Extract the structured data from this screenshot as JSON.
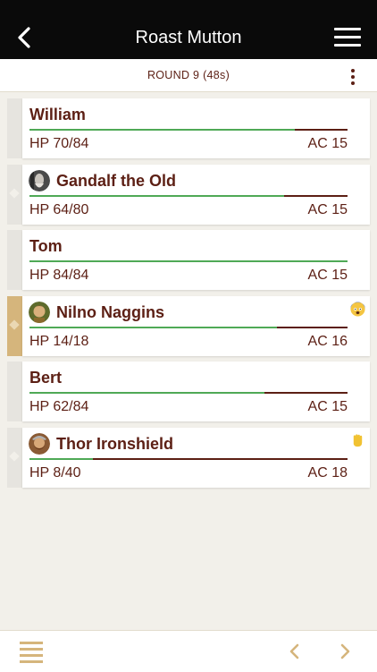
{
  "header": {
    "title": "Roast Mutton",
    "back_icon": "chevron-left-icon",
    "menu_icon": "hamburger-menu-icon"
  },
  "round": {
    "label": "ROUND 9 (48s)",
    "more_icon": "kebab-menu-icon"
  },
  "combatants": [
    {
      "name": "William",
      "hp": "HP 70/84",
      "ac": "AC 15",
      "hp_fraction": 0.833,
      "avatar": null,
      "condition_icon": null,
      "active": false
    },
    {
      "name": "Gandalf the Old",
      "hp": "HP 64/80",
      "ac": "AC 15",
      "hp_fraction": 0.8,
      "avatar": "avatar-gandalf",
      "condition_icon": null,
      "active": false
    },
    {
      "name": "Tom",
      "hp": "HP 84/84",
      "ac": "AC 15",
      "hp_fraction": 1.0,
      "avatar": null,
      "condition_icon": null,
      "active": false
    },
    {
      "name": "Nilno Naggins",
      "hp": "HP 14/18",
      "ac": "AC 16",
      "hp_fraction": 0.778,
      "avatar": "avatar-nilno",
      "condition_icon": "frightened-emoji-icon",
      "active": true
    },
    {
      "name": "Bert",
      "hp": "HP 62/84",
      "ac": "AC 15",
      "hp_fraction": 0.738,
      "avatar": null,
      "condition_icon": null,
      "active": false
    },
    {
      "name": "Thor Ironshield",
      "hp": "HP 8/40",
      "ac": "AC 18",
      "hp_fraction": 0.2,
      "avatar": "avatar-thor",
      "condition_icon": "grappled-hand-icon",
      "active": false
    }
  ],
  "footer": {
    "list_icon": "list-icon",
    "prev_icon": "chevron-left-icon",
    "next_icon": "chevron-right-icon"
  },
  "colors": {
    "accent": "#d5b57c",
    "text": "#5c1f14",
    "hp_fill": "#4fa956",
    "hp_empty": "#5c1f14",
    "header_bg": "#0a0a0a",
    "page_bg": "#f2f0ea"
  }
}
